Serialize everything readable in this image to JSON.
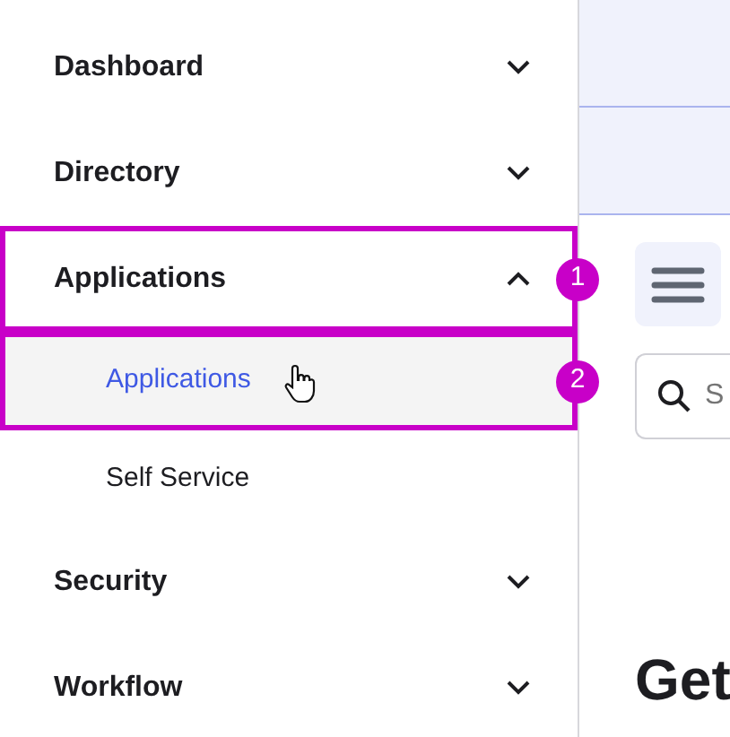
{
  "sidebar": {
    "items": [
      {
        "label": "Dashboard",
        "expanded": false
      },
      {
        "label": "Directory",
        "expanded": false
      },
      {
        "label": "Applications",
        "expanded": true,
        "callout": "1",
        "children": [
          {
            "label": "Applications",
            "selected": true,
            "callout": "2"
          },
          {
            "label": "Self Service",
            "selected": false
          }
        ]
      },
      {
        "label": "Security",
        "expanded": false
      },
      {
        "label": "Workflow",
        "expanded": false
      }
    ]
  },
  "main": {
    "search": {
      "placeholder": "S"
    },
    "heading": "Get"
  }
}
